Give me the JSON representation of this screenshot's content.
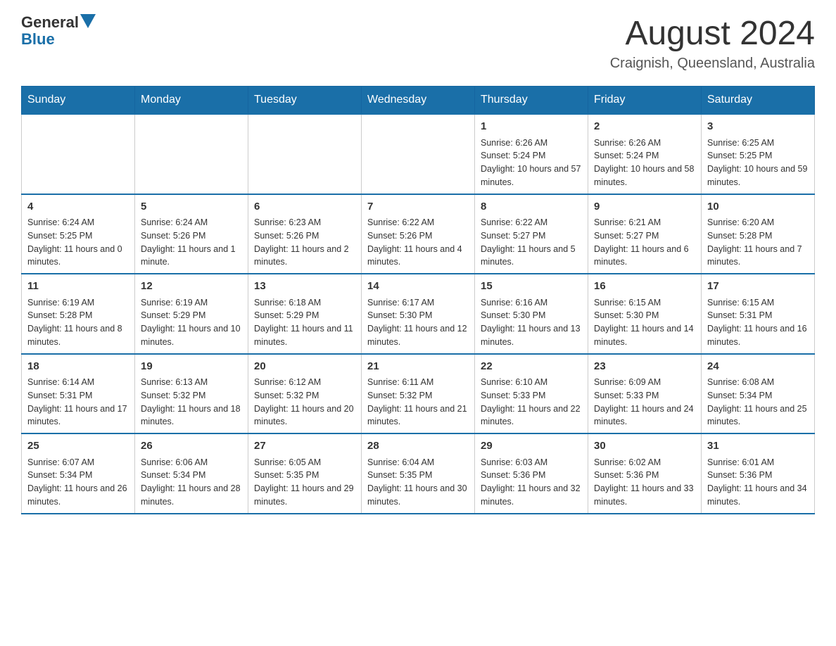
{
  "logo": {
    "text_general": "General",
    "text_blue": "Blue"
  },
  "title": "August 2024",
  "location": "Craignish, Queensland, Australia",
  "days_of_week": [
    "Sunday",
    "Monday",
    "Tuesday",
    "Wednesday",
    "Thursday",
    "Friday",
    "Saturday"
  ],
  "weeks": [
    [
      {
        "day": "",
        "info": ""
      },
      {
        "day": "",
        "info": ""
      },
      {
        "day": "",
        "info": ""
      },
      {
        "day": "",
        "info": ""
      },
      {
        "day": "1",
        "info": "Sunrise: 6:26 AM\nSunset: 5:24 PM\nDaylight: 10 hours and 57 minutes."
      },
      {
        "day": "2",
        "info": "Sunrise: 6:26 AM\nSunset: 5:24 PM\nDaylight: 10 hours and 58 minutes."
      },
      {
        "day": "3",
        "info": "Sunrise: 6:25 AM\nSunset: 5:25 PM\nDaylight: 10 hours and 59 minutes."
      }
    ],
    [
      {
        "day": "4",
        "info": "Sunrise: 6:24 AM\nSunset: 5:25 PM\nDaylight: 11 hours and 0 minutes."
      },
      {
        "day": "5",
        "info": "Sunrise: 6:24 AM\nSunset: 5:26 PM\nDaylight: 11 hours and 1 minute."
      },
      {
        "day": "6",
        "info": "Sunrise: 6:23 AM\nSunset: 5:26 PM\nDaylight: 11 hours and 2 minutes."
      },
      {
        "day": "7",
        "info": "Sunrise: 6:22 AM\nSunset: 5:26 PM\nDaylight: 11 hours and 4 minutes."
      },
      {
        "day": "8",
        "info": "Sunrise: 6:22 AM\nSunset: 5:27 PM\nDaylight: 11 hours and 5 minutes."
      },
      {
        "day": "9",
        "info": "Sunrise: 6:21 AM\nSunset: 5:27 PM\nDaylight: 11 hours and 6 minutes."
      },
      {
        "day": "10",
        "info": "Sunrise: 6:20 AM\nSunset: 5:28 PM\nDaylight: 11 hours and 7 minutes."
      }
    ],
    [
      {
        "day": "11",
        "info": "Sunrise: 6:19 AM\nSunset: 5:28 PM\nDaylight: 11 hours and 8 minutes."
      },
      {
        "day": "12",
        "info": "Sunrise: 6:19 AM\nSunset: 5:29 PM\nDaylight: 11 hours and 10 minutes."
      },
      {
        "day": "13",
        "info": "Sunrise: 6:18 AM\nSunset: 5:29 PM\nDaylight: 11 hours and 11 minutes."
      },
      {
        "day": "14",
        "info": "Sunrise: 6:17 AM\nSunset: 5:30 PM\nDaylight: 11 hours and 12 minutes."
      },
      {
        "day": "15",
        "info": "Sunrise: 6:16 AM\nSunset: 5:30 PM\nDaylight: 11 hours and 13 minutes."
      },
      {
        "day": "16",
        "info": "Sunrise: 6:15 AM\nSunset: 5:30 PM\nDaylight: 11 hours and 14 minutes."
      },
      {
        "day": "17",
        "info": "Sunrise: 6:15 AM\nSunset: 5:31 PM\nDaylight: 11 hours and 16 minutes."
      }
    ],
    [
      {
        "day": "18",
        "info": "Sunrise: 6:14 AM\nSunset: 5:31 PM\nDaylight: 11 hours and 17 minutes."
      },
      {
        "day": "19",
        "info": "Sunrise: 6:13 AM\nSunset: 5:32 PM\nDaylight: 11 hours and 18 minutes."
      },
      {
        "day": "20",
        "info": "Sunrise: 6:12 AM\nSunset: 5:32 PM\nDaylight: 11 hours and 20 minutes."
      },
      {
        "day": "21",
        "info": "Sunrise: 6:11 AM\nSunset: 5:32 PM\nDaylight: 11 hours and 21 minutes."
      },
      {
        "day": "22",
        "info": "Sunrise: 6:10 AM\nSunset: 5:33 PM\nDaylight: 11 hours and 22 minutes."
      },
      {
        "day": "23",
        "info": "Sunrise: 6:09 AM\nSunset: 5:33 PM\nDaylight: 11 hours and 24 minutes."
      },
      {
        "day": "24",
        "info": "Sunrise: 6:08 AM\nSunset: 5:34 PM\nDaylight: 11 hours and 25 minutes."
      }
    ],
    [
      {
        "day": "25",
        "info": "Sunrise: 6:07 AM\nSunset: 5:34 PM\nDaylight: 11 hours and 26 minutes."
      },
      {
        "day": "26",
        "info": "Sunrise: 6:06 AM\nSunset: 5:34 PM\nDaylight: 11 hours and 28 minutes."
      },
      {
        "day": "27",
        "info": "Sunrise: 6:05 AM\nSunset: 5:35 PM\nDaylight: 11 hours and 29 minutes."
      },
      {
        "day": "28",
        "info": "Sunrise: 6:04 AM\nSunset: 5:35 PM\nDaylight: 11 hours and 30 minutes."
      },
      {
        "day": "29",
        "info": "Sunrise: 6:03 AM\nSunset: 5:36 PM\nDaylight: 11 hours and 32 minutes."
      },
      {
        "day": "30",
        "info": "Sunrise: 6:02 AM\nSunset: 5:36 PM\nDaylight: 11 hours and 33 minutes."
      },
      {
        "day": "31",
        "info": "Sunrise: 6:01 AM\nSunset: 5:36 PM\nDaylight: 11 hours and 34 minutes."
      }
    ]
  ]
}
